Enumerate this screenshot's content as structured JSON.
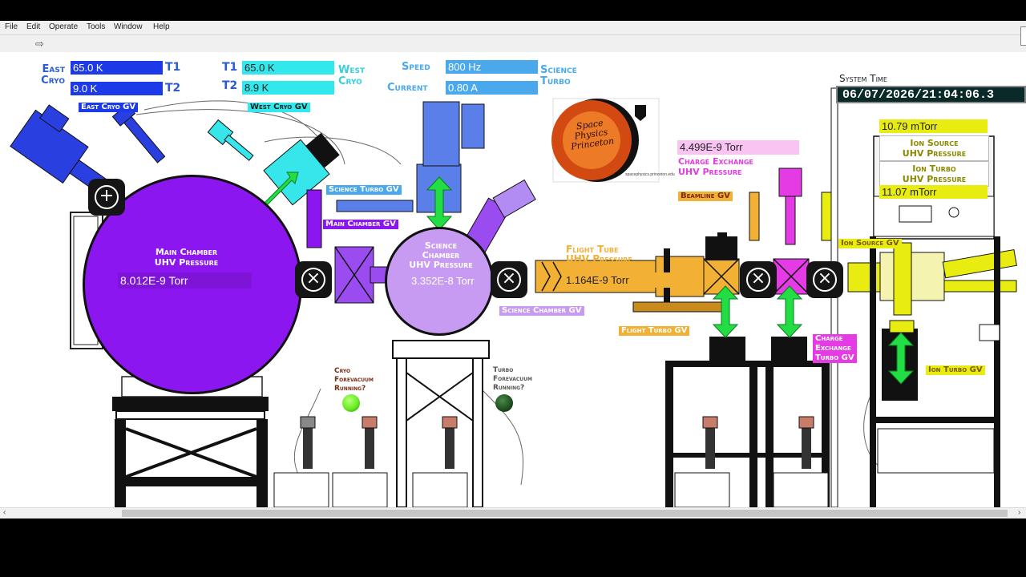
{
  "menu": {
    "items": [
      "File",
      "Edit",
      "Operate",
      "Tools",
      "Window",
      "Help"
    ]
  },
  "toolbar": {
    "run_icon": "run-arrow-icon"
  },
  "cryo": {
    "east_label": "East\nCryo",
    "west_label": "West\nCryo",
    "t1_label": "T1",
    "t2_label": "T2",
    "east_t1": "65.0 K",
    "east_t2": "9.0 K",
    "west_t1": "65.0 K",
    "west_t2": "8.9 K"
  },
  "turbo": {
    "speed_label": "Speed",
    "current_label": "Current",
    "speed": "800 Hz",
    "current": "0.80 A",
    "science_turbo_label": "Science\nTurbo"
  },
  "valves": {
    "east_cryo_gv": "East Cryo GV",
    "west_cryo_gv": "West Cryo GV",
    "science_turbo_gv": "Science Turbo GV",
    "main_chamber_gv": "Main Chamber GV",
    "science_chamber_gv": "Science Chamber GV",
    "beamline_gv": "Beamline GV",
    "flight_turbo_gv": "Flight Turbo GV",
    "ion_source_gv": "Ion Source GV",
    "ion_turbo_gv": "Ion Turbo GV",
    "charge_exchange_turbo_gv": "Charge\nExchange\nTurbo GV"
  },
  "main_chamber": {
    "title": "Main Chamber\nUHV Pressure",
    "pressure": "8.012E-9 Torr"
  },
  "science_chamber": {
    "title": "Science\nChamber\nUHV Pressure",
    "pressure": "3.352E-8 Torr"
  },
  "flight_tube": {
    "title": "Flight Tube\nUHV Pressure",
    "pressure": "1.164E-9 Torr"
  },
  "charge_exchange": {
    "title": "Charge Exchange\nUHV Pressure",
    "pressure": "4.499E-9 Torr"
  },
  "ion": {
    "source_pressure": "10.79  mTorr",
    "source_label": "Ion Source\nUHV Pressure",
    "turbo_label": "Ion Turbo\nUHV Pressure",
    "turbo_pressure": "11.07  mTorr"
  },
  "status": {
    "cryo_forevacuum": "Cryo\nForevacuum\nRunning?",
    "turbo_forevacuum": "Turbo\nForevacuum\nRunning?",
    "cryo_on": true,
    "turbo_on": false
  },
  "system_time": {
    "label": "System Time",
    "value": "06/07/2026/21:04:06.3"
  },
  "logo": {
    "text": "Space\nPhysics\nPrinceton",
    "caption": "spacephysics.princeton.edu"
  },
  "colors": {
    "main_chamber": "#8b16f0",
    "science_chamber": "#c89bf2",
    "flight_tube": "#f2b035",
    "east_blue": "#1c3ae8",
    "west_cyan": "#33e8ec",
    "turbo_blue": "#4aa9ec",
    "charge_pink": "#e43be4",
    "ion_yellow": "#e8ec10",
    "arrow_green": "#22dd44",
    "label_blue": "#2a5ccf",
    "dark_text": "#7a2b12",
    "lamp_on": "#66ee22",
    "lamp_off": "#1e4d1e"
  }
}
